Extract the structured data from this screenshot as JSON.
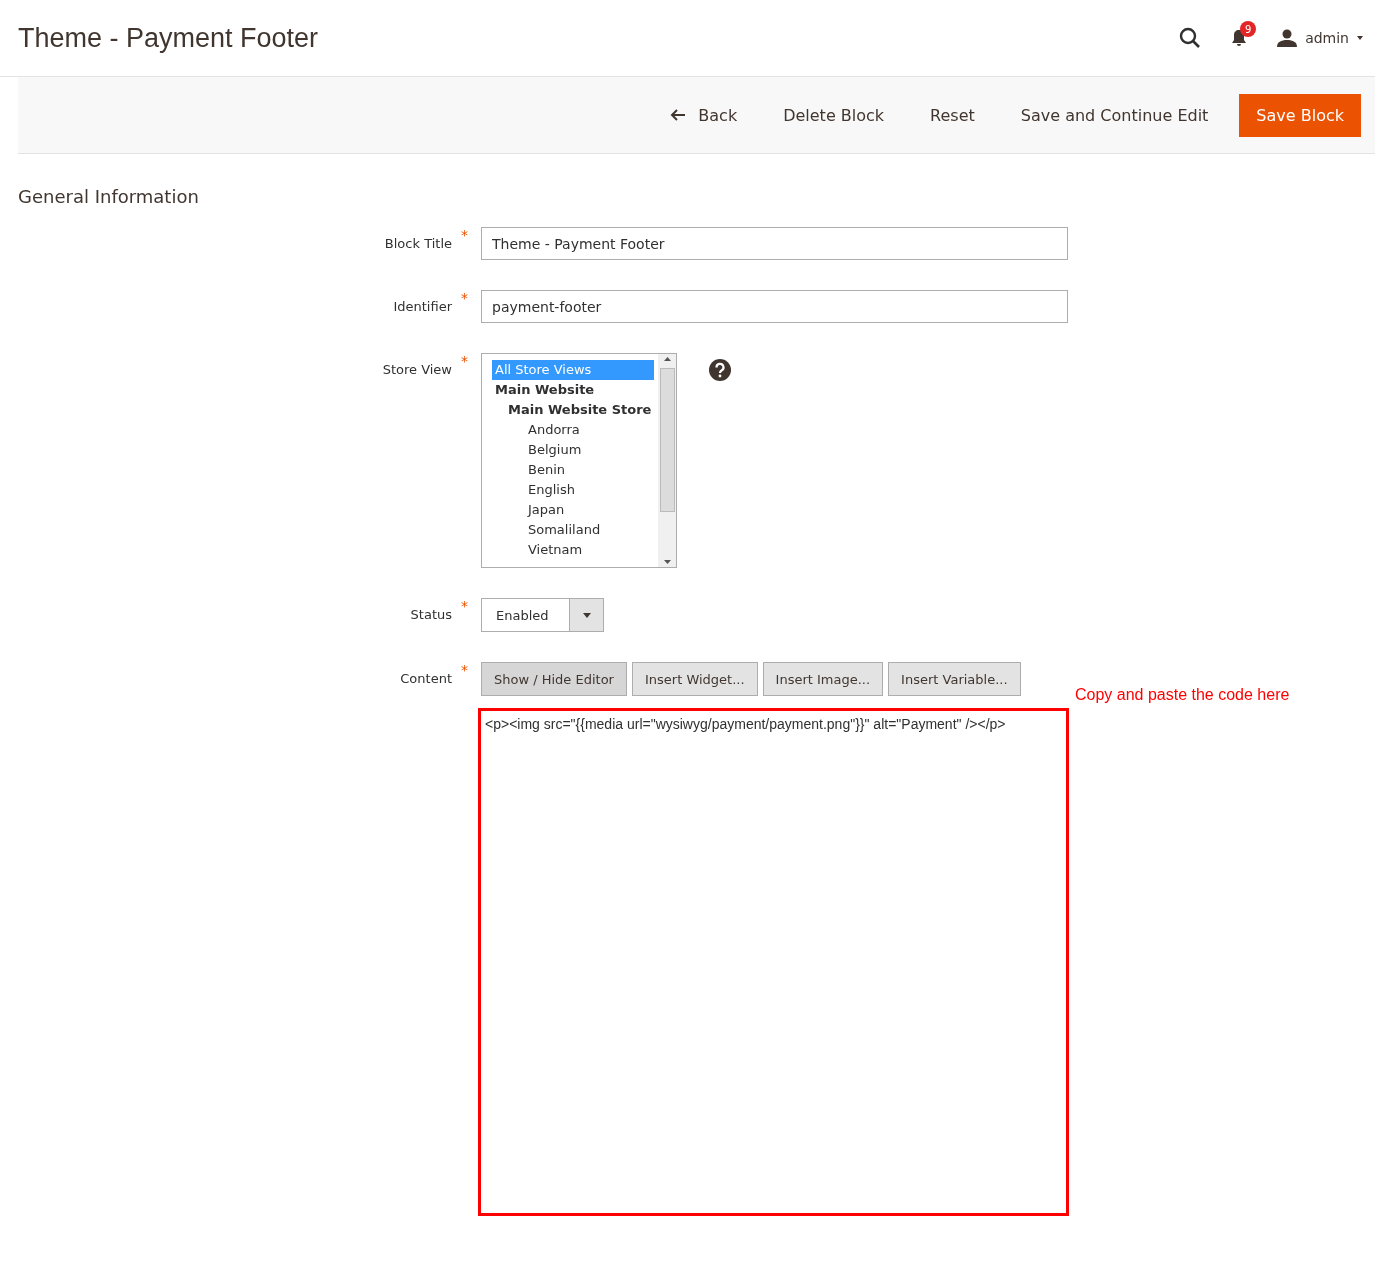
{
  "page_title": "Theme - Payment Footer",
  "header": {
    "notifications_count": "9",
    "user": "admin"
  },
  "toolbar": {
    "back": "Back",
    "actions": [
      "Delete Block",
      "Reset",
      "Save and Continue Edit"
    ],
    "primary": "Save Block"
  },
  "section_title": "General Information",
  "fields": [
    {
      "kind": "text",
      "label": "Block Title",
      "required_mark": "*",
      "value": "Theme - Payment Footer"
    },
    {
      "kind": "text",
      "label": "Identifier",
      "required_mark": "*",
      "value": "payment-footer"
    },
    {
      "kind": "multiselect",
      "label": "Store View",
      "required_mark": "*",
      "options": [
        {
          "label": "All Store Views",
          "selected": true
        },
        {
          "label": "Main Website",
          "children": [
            {
              "label": "Main Website Store",
              "children": [
                {
                  "label": "Andorra",
                  "selected": false
                },
                {
                  "label": "Belgium",
                  "selected": false
                },
                {
                  "label": "Benin",
                  "selected": false
                },
                {
                  "label": "English",
                  "selected": false
                },
                {
                  "label": "Japan",
                  "selected": false
                },
                {
                  "label": "Somaliland",
                  "selected": false
                },
                {
                  "label": "Vietnam",
                  "selected": false
                }
              ]
            }
          ]
        }
      ]
    },
    {
      "kind": "select",
      "label": "Status",
      "required_mark": "*",
      "value": "Enabled"
    },
    {
      "kind": "editor",
      "label": "Content",
      "required_mark": "*",
      "buttons": [
        {
          "label": "Show / Hide Editor",
          "selected": true
        },
        {
          "label": "Insert Widget...",
          "selected": false
        },
        {
          "label": "Insert Image...",
          "selected": false
        },
        {
          "label": "Insert Variable...",
          "selected": false
        }
      ],
      "value": "<p><img src=\"{{media url=\"wysiwyg/payment/payment.png\"}}\" alt=\"Payment\" /></p>",
      "annotation": "Copy and paste the code here"
    }
  ]
}
